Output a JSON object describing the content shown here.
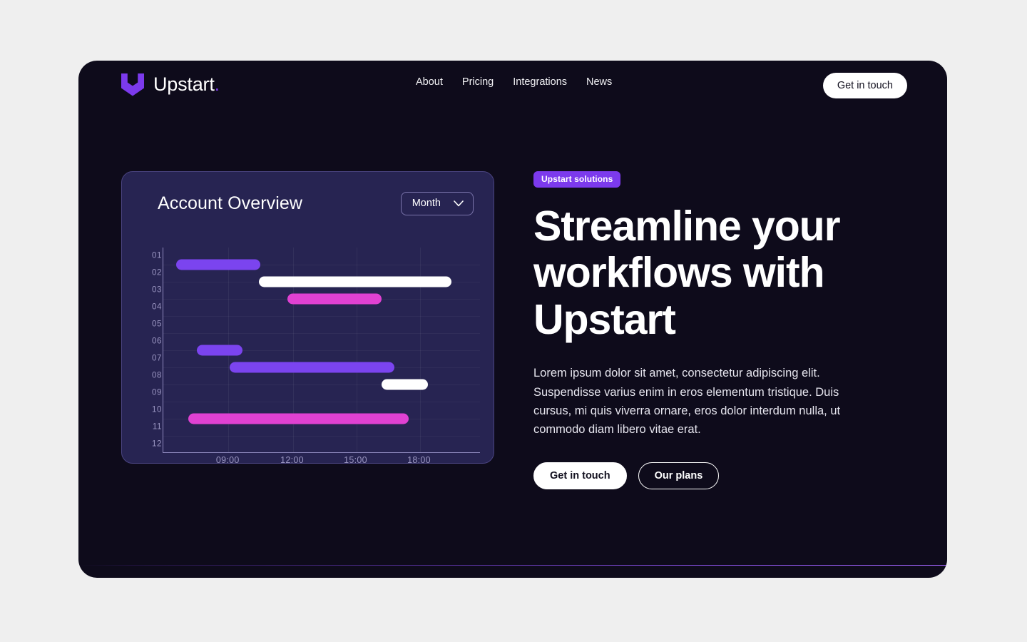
{
  "theme": {
    "page_bg": "#efefef",
    "hero_bg": "#0e0b1b",
    "card_bg": "#272452",
    "card_border": "#4a4480",
    "accent_purple": "#7c3aed",
    "accent_violet": "#7b44ef",
    "accent_pink": "#e041d2",
    "accent_white": "#ffffff",
    "muted_text": "#9b96c2"
  },
  "header": {
    "brand_name": "Upstart",
    "brand_dot": ".",
    "logo_icon": "upstart-shield-icon",
    "nav": [
      {
        "label": "About"
      },
      {
        "label": "Pricing"
      },
      {
        "label": "Integrations"
      },
      {
        "label": "News"
      }
    ],
    "cta_label": "Get in touch"
  },
  "card": {
    "title": "Account Overview",
    "range_value": "Month",
    "range_icon": "chevron-down-icon",
    "range_options": [
      "Month"
    ]
  },
  "hero": {
    "badge": "Upstart solutions",
    "headline": "Streamline your workflows with Upstart",
    "paragraph": "Lorem ipsum dolor sit amet, consectetur adipiscing elit. Suspendisse varius enim in eros elementum tristique. Duis cursus, mi quis viverra ornare, eros dolor interdum nulla, ut commodo diam libero vitae erat.",
    "primary_cta": "Get in touch",
    "secondary_cta": "Our plans"
  },
  "chart_data": {
    "type": "bar",
    "subtype": "gantt",
    "title": "Account Overview",
    "xlabel": "",
    "ylabel": "",
    "grid": true,
    "legend": "none",
    "categories": [
      "01",
      "02",
      "03",
      "04",
      "05",
      "06",
      "07",
      "08",
      "09",
      "10",
      "11",
      "12"
    ],
    "y_tick_labels": [
      "01",
      "02",
      "03",
      "04",
      "05",
      "06",
      "07",
      "08",
      "09",
      "10",
      "11",
      "12"
    ],
    "x_tick_labels": [
      "09:00",
      "12:00",
      "15:00",
      "18:00"
    ],
    "x_tick_positions": [
      0.205,
      0.408,
      0.608,
      0.808
    ],
    "xlim": [
      "07:30",
      "21:00"
    ],
    "bars": [
      {
        "row": "01",
        "row_index": 0,
        "start": "08:00",
        "end": "10:40",
        "start_frac": 0.04,
        "end_frac": 0.305,
        "color": "#7b44ef",
        "color_name": "violet"
      },
      {
        "row": "02",
        "row_index": 1,
        "start": "10:50",
        "end": "18:50",
        "start_frac": 0.302,
        "end_frac": 0.908,
        "color": "#ffffff",
        "color_name": "white"
      },
      {
        "row": "03",
        "row_index": 2,
        "start": "12:00",
        "end": "15:05",
        "start_frac": 0.39,
        "end_frac": 0.687,
        "color": "#e041d2",
        "color_name": "pink"
      },
      {
        "row": "06",
        "row_index": 5,
        "start": "08:50",
        "end": "10:05",
        "start_frac": 0.105,
        "end_frac": 0.25,
        "color": "#7b44ef",
        "color_name": "violet"
      },
      {
        "row": "07",
        "row_index": 6,
        "start": "09:55",
        "end": "15:40",
        "start_frac": 0.208,
        "end_frac": 0.727,
        "color": "#7b44ef",
        "color_name": "violet"
      },
      {
        "row": "08",
        "row_index": 7,
        "start": "16:55",
        "end": "18:20",
        "start_frac": 0.688,
        "end_frac": 0.833,
        "color": "#ffffff",
        "color_name": "white"
      },
      {
        "row": "10",
        "row_index": 9,
        "start": "08:35",
        "end": "16:10",
        "start_frac": 0.078,
        "end_frac": 0.772,
        "color": "#e041d2",
        "color_name": "pink"
      }
    ]
  }
}
